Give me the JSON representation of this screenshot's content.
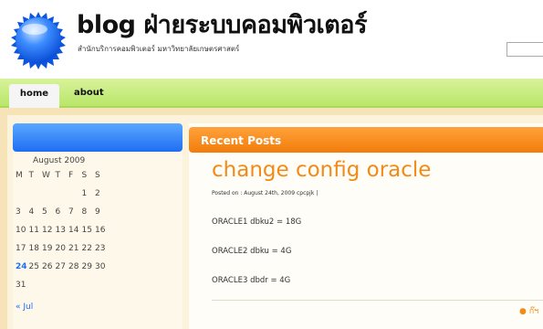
{
  "header": {
    "title": "blog ฝ่ายระบบคอมพิวเตอร์",
    "subtitle": "สำนักบริการคอมพิวเตอร์ มหาวิทยาลัยเกษตรศาสตร์"
  },
  "nav": {
    "items": [
      {
        "label": "home"
      },
      {
        "label": "about"
      }
    ]
  },
  "calendar": {
    "caption": "August 2009",
    "weekdays": [
      "M",
      "T",
      "W",
      "T",
      "F",
      "S",
      "S"
    ],
    "rows": [
      [
        "",
        "",
        "",
        "",
        "",
        "1",
        "2"
      ],
      [
        "3",
        "4",
        "5",
        "6",
        "7",
        "8",
        "9"
      ],
      [
        "10",
        "11",
        "12",
        "13",
        "14",
        "15",
        "16"
      ],
      [
        "17",
        "18",
        "19",
        "20",
        "21",
        "22",
        "23"
      ],
      [
        "24",
        "25",
        "26",
        "27",
        "28",
        "29",
        "30"
      ],
      [
        "31",
        "",
        "",
        "",
        "",
        "",
        ""
      ]
    ],
    "today": "24",
    "prev_label": "« Jul"
  },
  "main": {
    "header": "Recent Posts",
    "post": {
      "title": "change config oracle",
      "meta": "Posted on : August 24th, 2009 cpcpjk |",
      "lines": [
        "ORACLE1 dbku2 = 18G",
        "ORACLE2 dbku = 4G",
        "ORACLE3 dbdr = 4G"
      ],
      "comment_link": "ก๊ฯ"
    }
  },
  "colors": {
    "accent_orange": "#f28a17",
    "accent_blue": "#1f6df2",
    "nav_green": "#b9e66a"
  }
}
